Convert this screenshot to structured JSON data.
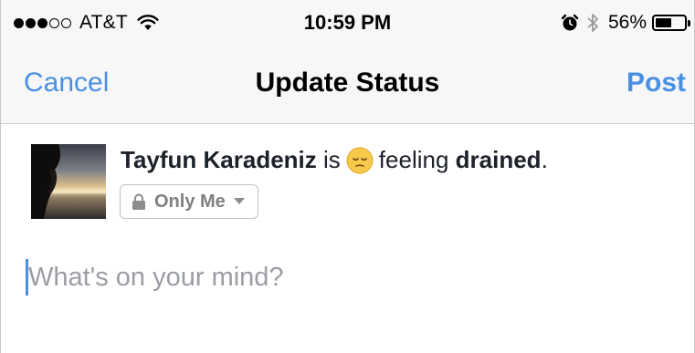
{
  "status_bar": {
    "signal_bars_filled": 3,
    "signal_bars_total": 5,
    "carrier": "AT&T",
    "time": "10:59 PM",
    "battery_percent": "56%",
    "battery_level": 0.56,
    "icons": [
      "wifi-icon",
      "alarm-icon",
      "bluetooth-icon",
      "battery-icon"
    ]
  },
  "nav": {
    "cancel_label": "Cancel",
    "title": "Update Status",
    "post_label": "Post",
    "accent_color": "#4a90e2"
  },
  "post": {
    "user_name": "Tayfun Karadeniz",
    "connector_is": "is",
    "feeling_emoji": "relieved-face-emoji",
    "feeling_prefix": "feeling",
    "feeling": "drained",
    "feeling_suffix": ".",
    "privacy_label": "Only Me",
    "privacy_icon": "lock-icon",
    "composer_placeholder": "What's on your mind?"
  }
}
